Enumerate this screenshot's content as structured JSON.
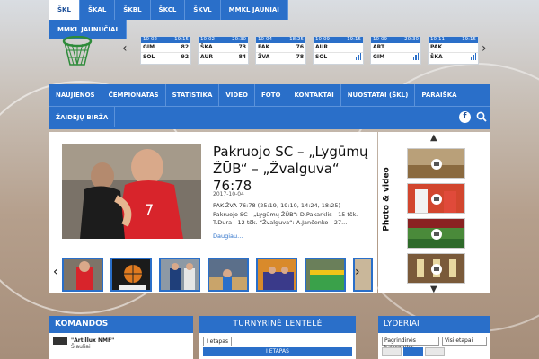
{
  "league_tabs": [
    {
      "label": "ŠKL",
      "active": true
    },
    {
      "label": "ŠKAL",
      "active": false
    },
    {
      "label": "ŠKBL",
      "active": false
    },
    {
      "label": "ŠKCL",
      "active": false
    },
    {
      "label": "ŠKVL",
      "active": false
    },
    {
      "label": "MMKL JAUNIAI",
      "active": false
    }
  ],
  "league_tabs_row2": [
    {
      "label": "MMKL JAUNUČIAI"
    }
  ],
  "scores": [
    {
      "date": "10-02",
      "time": "19:15",
      "home": "GIM",
      "home_score": "82",
      "away": "SOL",
      "away_score": "92"
    },
    {
      "date": "10-02",
      "time": "20:30",
      "home": "ŠKA",
      "home_score": "73",
      "away": "AUR",
      "away_score": "84"
    },
    {
      "date": "10-04",
      "time": "18:25",
      "home": "PAK",
      "home_score": "76",
      "away": "ŽVA",
      "away_score": "78"
    },
    {
      "date": "10-09",
      "time": "19:15",
      "home": "AUR",
      "home_score": "",
      "away": "SOL",
      "away_score": ""
    },
    {
      "date": "10-09",
      "time": "20:30",
      "home": "ART",
      "home_score": "",
      "away": "GIM",
      "away_score": ""
    },
    {
      "date": "10-11",
      "time": "19:15",
      "home": "PAK",
      "home_score": "",
      "away": "ŠKA",
      "away_score": ""
    }
  ],
  "nav": {
    "row1": [
      "NAUJIENOS",
      "ČEMPIONATAS",
      "STATISTIKA",
      "VIDEO",
      "FOTO",
      "KONTAKTAI",
      "NUOSTATAI (ŠKL)",
      "PARAIŠKA"
    ],
    "row2": [
      "ŽAIDĖJŲ BIRŽA"
    ],
    "facebook_icon": "f"
  },
  "feature": {
    "title": "Pakruojo SC – „Lygūmų ŽŪB“ – „Žvalguva“ 76:78",
    "date": "2017-10-04",
    "excerpt": "PAK-ŽVA 76:78 (25:19, 19:10, 14:24, 18:25) Pakruojo SC - „Lygūmų ŽŪB“: D.Pakarklis - 15 tšk. T.Dura - 12 tšk. “Žvalguva“: A.Jančenko - 27...",
    "more": "Daugiau..."
  },
  "media": {
    "label": "Photo & video"
  },
  "panels": {
    "komandos": {
      "title": "KOMANDOS",
      "team_name": "\"Artillux NMF\"",
      "team_city": "Šiauliai"
    },
    "turnyrine": {
      "title": "TURNYRINĖ LENTELĖ",
      "tab": "I etapas",
      "head": "I ETAPAS"
    },
    "lyderiai": {
      "title": "LYDERIAI",
      "select1": "Pagrindinės kategorijos",
      "select2": "Visi etapai",
      "tabs": [
        "",
        "",
        ""
      ]
    }
  },
  "colors": {
    "brand_blue": "#2a6fc9",
    "white": "#ffffff"
  }
}
